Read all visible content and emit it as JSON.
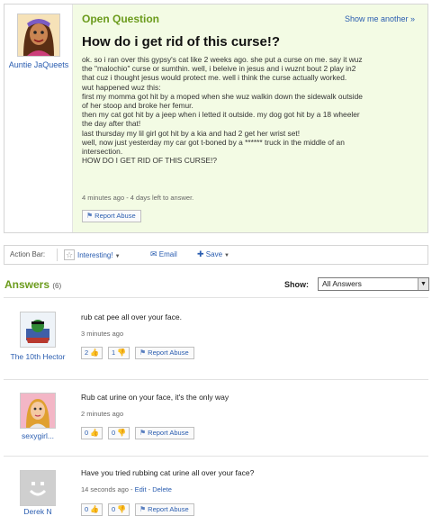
{
  "question": {
    "label": "Open Question",
    "show_another": "Show me another »",
    "title": "How do i get rid of this curse!?",
    "author": "Auntie JaQueets",
    "body_lines": [
      "ok. so i ran over this gypsy's cat like 2 weeks ago. she put a curse on me. say it wuz",
      "the \"malochio\" curse or sumthin. well, i beleive in jesus and i wuznt bout 2 play in2",
      "that cuz i thought jesus would protect me. well i think the curse actually worked.",
      "wut happened wuz this:",
      "first my momma got hit by a moped when she wuz walkin down the sidewalk outside",
      "of her stoop and broke her femur.",
      "then my cat got hit by a jeep when i letted it outside. my dog got hit by a 18 wheeler",
      "the day after that!",
      "last thursday my lil girl got hit by a kia and had 2 get her wrist set!",
      "well, now just yesterday my car got t-boned by a ****** truck in the middle of an",
      "intersection.",
      "HOW DO I GET RID OF THIS CURSE!?"
    ],
    "meta": "4 minutes ago - 4 days left to answer.",
    "report_abuse": "Report Abuse"
  },
  "action_bar": {
    "label": "Action Bar:",
    "interesting": "Interesting!",
    "email": "Email",
    "save": "Save"
  },
  "answers_section": {
    "title": "Answers",
    "count": "(6)",
    "show_label": "Show:",
    "show_value": "All Answers"
  },
  "answers": [
    {
      "author": "The 10th Hector",
      "text": "rub cat pee all over your face.",
      "meta": "3 minutes ago",
      "up": "2",
      "down": "1",
      "report": "Report Abuse"
    },
    {
      "author": "sexygirl...",
      "text": "Rub cat urine on your face, it's the only way",
      "meta": "2 minutes ago",
      "up": "0",
      "down": "0",
      "report": "Report Abuse"
    },
    {
      "author": "Derek N",
      "text": "Have you tried rubbing cat urine all over your face?",
      "meta_time": "14 seconds ago - ",
      "meta_edit": "Edit",
      "meta_sep": " - ",
      "meta_delete": "Delete",
      "up": "0",
      "down": "0",
      "report": "Report Abuse"
    }
  ],
  "icons": {
    "flag": "flag-icon",
    "star": "star-icon",
    "email": "envelope-icon",
    "save": "plus-icon",
    "thumbs_up": "thumbs-up-icon",
    "thumbs_down": "thumbs-down-icon"
  },
  "colors": {
    "accent_green": "#6b9b1c",
    "link_blue": "#2a5db0",
    "question_bg": "#f3fbe4"
  }
}
